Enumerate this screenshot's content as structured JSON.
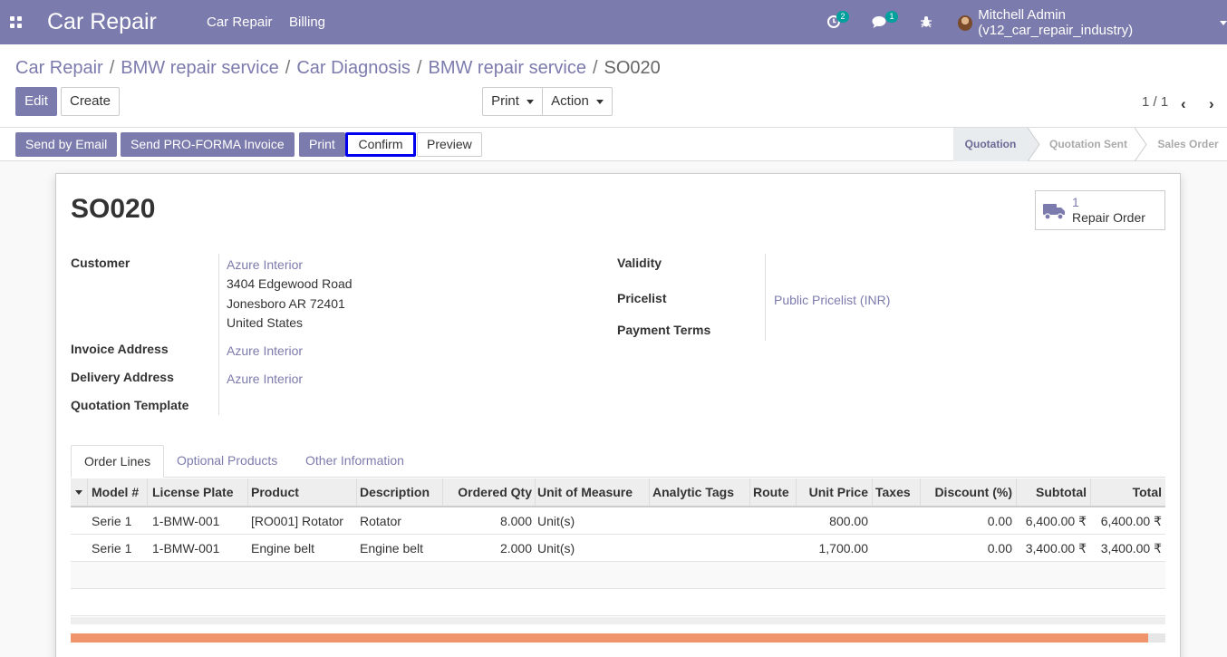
{
  "navbar": {
    "brand": "Car Repair",
    "menu": [
      "Car Repair",
      "Billing"
    ],
    "activity_count": "2",
    "messages_count": "1",
    "user": "Mitchell Admin (v12_car_repair_industry)"
  },
  "breadcrumb": [
    "Car Repair",
    "BMW repair service",
    "Car Diagnosis",
    "BMW repair service",
    "SO020"
  ],
  "actions": {
    "edit": "Edit",
    "create": "Create",
    "print": "Print",
    "action": "Action"
  },
  "pager": {
    "text": "1 / 1"
  },
  "statusbar": {
    "buttons": [
      "Send by Email",
      "Send PRO-FORMA Invoice",
      "Print",
      "Confirm",
      "Preview"
    ],
    "stages": [
      "Quotation",
      "Quotation Sent",
      "Sales Order"
    ],
    "active_stage": "Quotation"
  },
  "record": {
    "name": "SO020",
    "smart_button": {
      "count": "1",
      "label": "Repair Order"
    },
    "left_fields": {
      "customer_label": "Customer",
      "customer_name": "Azure Interior",
      "customer_address": [
        "3404 Edgewood Road",
        "Jonesboro AR 72401",
        "United States"
      ],
      "invoice_address_label": "Invoice Address",
      "invoice_address": "Azure Interior",
      "delivery_address_label": "Delivery Address",
      "delivery_address": "Azure Interior",
      "quotation_template_label": "Quotation Template",
      "quotation_template": ""
    },
    "right_fields": {
      "validity_label": "Validity",
      "validity": "",
      "pricelist_label": "Pricelist",
      "pricelist": "Public Pricelist (INR)",
      "payment_terms_label": "Payment Terms",
      "payment_terms": ""
    }
  },
  "tabs": [
    "Order Lines",
    "Optional Products",
    "Other Information"
  ],
  "order_lines": {
    "columns": [
      "Model #",
      "License Plate",
      "Product",
      "Description",
      "Ordered Qty",
      "Unit of Measure",
      "Analytic Tags",
      "Route",
      "Unit Price",
      "Taxes",
      "Discount (%)",
      "Subtotal",
      "Total"
    ],
    "rows": [
      [
        "Serie 1",
        "1-BMW-001",
        "[RO001] Rotator",
        "Rotator",
        "8.000",
        "Unit(s)",
        "",
        "",
        "800.00",
        "",
        "0.00",
        "6,400.00 ₹",
        "6,400.00 ₹"
      ],
      [
        "Serie 1",
        "1-BMW-001",
        "Engine belt",
        "Engine belt",
        "2.000",
        "Unit(s)",
        "",
        "",
        "1,700.00",
        "",
        "0.00",
        "3,400.00 ₹",
        "3,400.00 ₹"
      ]
    ]
  },
  "progress_fraction": 0.984,
  "colors": {
    "primary": "#7c7bad",
    "progress": "#f0956b",
    "highlight": "#0000ee"
  }
}
